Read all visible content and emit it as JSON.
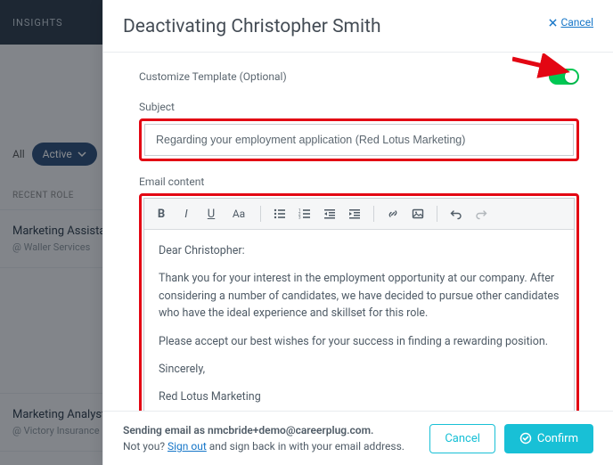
{
  "bg": {
    "nav_insights": "INSIGHTS",
    "filter_all": "All",
    "filter_active": "Active",
    "col_role": "RECENT ROLE",
    "rows": [
      {
        "title": "Marketing Assistant",
        "sub": "@ Waller Services"
      },
      {
        "title": "Marketing Analyst",
        "sub": "@ Victory Insurance"
      }
    ]
  },
  "modal": {
    "title": "Deactivating Christopher Smith",
    "cancel": "Cancel",
    "customize_label": "Customize Template (Optional)",
    "subject_label": "Subject",
    "subject_value": "Regarding your employment application (Red Lotus Marketing)",
    "content_label": "Email content",
    "body": {
      "greeting": "Dear Christopher:",
      "p1": "Thank you for your interest in the employment opportunity at our company. After considering a number of candidates, we have decided to pursue other candidates who have the ideal experience and skillset for this role.",
      "p2": "Please accept our best wishes for your success in finding a rewarding position.",
      "signoff": "Sincerely,",
      "signature": "Red Lotus Marketing"
    },
    "toolbar": {
      "font_size_label": "Aa"
    }
  },
  "footer": {
    "line1_a": "Sending email as ",
    "line1_b": "nmcbride+demo@careerplug.com.",
    "line2_a": "Not you? ",
    "line2_link": "Sign out",
    "line2_b": " and sign back in with your email address.",
    "cancel": "Cancel",
    "confirm": "Confirm"
  }
}
